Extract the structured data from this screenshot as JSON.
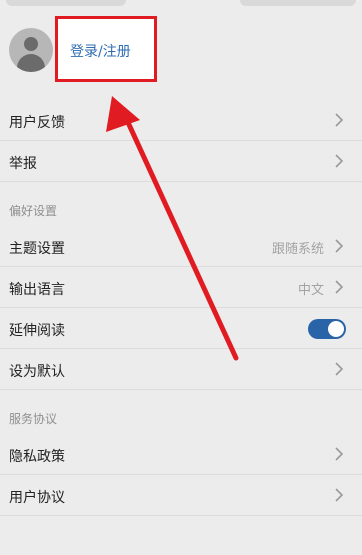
{
  "profile": {
    "avatar_icon": "avatar-icon",
    "login_label": "登录/注册"
  },
  "rows_top": [
    {
      "label": "用户反馈"
    },
    {
      "label": "举报"
    }
  ],
  "section_pref": {
    "title": "偏好设置",
    "items": [
      {
        "label": "主题设置",
        "value": "跟随系统"
      },
      {
        "label": "输出语言",
        "value": "中文"
      },
      {
        "label": "延伸阅读",
        "toggle": true
      },
      {
        "label": "设为默认"
      }
    ]
  },
  "section_service": {
    "title": "服务协议",
    "items": [
      {
        "label": "隐私政策"
      },
      {
        "label": "用户协议"
      }
    ]
  },
  "colors": {
    "accent_blue": "#2f6db2",
    "highlight_red": "#e11b22",
    "toggle_on": "#2a64a8"
  }
}
